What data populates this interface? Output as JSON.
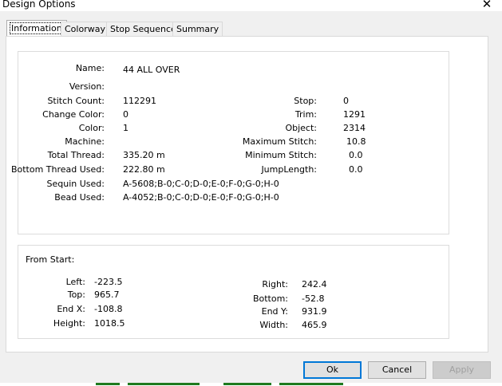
{
  "window": {
    "title": "Design Options"
  },
  "tabs": [
    {
      "label": "Information",
      "active": true
    },
    {
      "label": "Colorway"
    },
    {
      "label": "Stop Sequence"
    },
    {
      "label": "Summary"
    }
  ],
  "info": {
    "left_fields": [
      {
        "label": "Name:",
        "value": "44 ALL OVER"
      },
      {
        "label": "Version:",
        "value": ""
      },
      {
        "label": "Stitch Count:",
        "value": "112291"
      },
      {
        "label": "Change Color:",
        "value": "0"
      },
      {
        "label": "Color:",
        "value": "1"
      },
      {
        "label": "Machine:",
        "value": ""
      },
      {
        "label": "Total Thread:",
        "value": "335.20 m"
      },
      {
        "label": "Bottom Thread Used:",
        "value": "222.80 m"
      },
      {
        "label": "Sequin Used:",
        "value": "A-5608;B-0;C-0;D-0;E-0;F-0;G-0;H-0"
      },
      {
        "label": "Bead Used:",
        "value": "A-4052;B-0;C-0;D-0;E-0;F-0;G-0;H-0"
      }
    ],
    "right_fields": [
      {
        "label": "Stop:",
        "value": "0"
      },
      {
        "label": "Trim:",
        "value": "1291"
      },
      {
        "label": "Object:",
        "value": "2314"
      },
      {
        "label": "Maximum Stitch:",
        "value": "10.8"
      },
      {
        "label": "Minimum Stitch:",
        "value": "0.0"
      },
      {
        "label": "JumpLength:",
        "value": "0.0"
      }
    ]
  },
  "from_start": {
    "heading": "From Start:",
    "left_fields": [
      {
        "label": "Left:",
        "value": "-223.5"
      },
      {
        "label": "Top:",
        "value": "965.7"
      },
      {
        "label": "End X:",
        "value": "-108.8"
      },
      {
        "label": "Height:",
        "value": "1018.5"
      }
    ],
    "right_fields": [
      {
        "label": "Right:",
        "value": "242.4"
      },
      {
        "label": "Bottom:",
        "value": "-52.8"
      },
      {
        "label": "End Y:",
        "value": "931.9"
      },
      {
        "label": "Width:",
        "value": "465.9"
      }
    ]
  },
  "buttons": {
    "ok": "Ok",
    "cancel": "Cancel",
    "apply": "Apply"
  }
}
